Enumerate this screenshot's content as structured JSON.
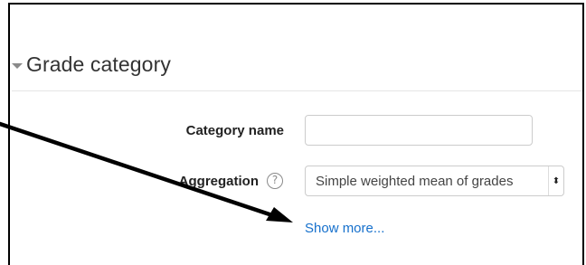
{
  "section": {
    "title": "Grade category"
  },
  "fields": {
    "category_name": {
      "label": "Category name",
      "value": ""
    },
    "aggregation": {
      "label": "Aggregation",
      "help_icon": "question-circle-icon",
      "help_glyph": "?",
      "selected": "Simple weighted mean of grades"
    }
  },
  "links": {
    "show_more": "Show more..."
  },
  "colors": {
    "link": "#1670cc",
    "annotation_arrow": "#000000"
  }
}
